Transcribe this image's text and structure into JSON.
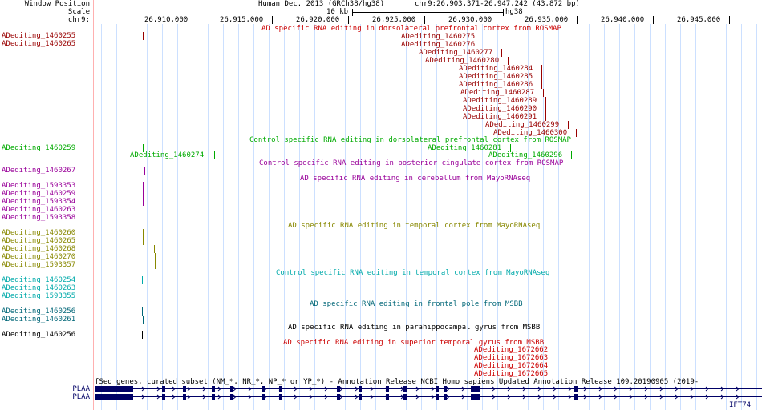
{
  "header": {
    "window_position_label": "Window Position",
    "assembly": "Human Dec. 2013 (GRCh38/hg38)",
    "position": "chr9:26,903,371-26,947,242 (43,872 bp)",
    "scale_label": "Scale",
    "scale_value": "10 kb",
    "scale_assembly": "hg38",
    "chrom_label": "chr9:",
    "ticks": [
      "26,910,000",
      "26,915,000",
      "26,920,000",
      "26,925,000",
      "26,930,000",
      "26,935,000",
      "26,940,000",
      "26,945,000"
    ]
  },
  "colors": {
    "darkred": "#990000",
    "green": "#00aa00",
    "purple": "#990099",
    "olive": "#888800",
    "cyan": "#00aaaa",
    "teal": "#006677",
    "black": "#000000",
    "red": "#cc0000",
    "navy": "#000066",
    "gridline": "#cce0ff",
    "divider": "#ffb0b0"
  },
  "tracks": {
    "t1": {
      "title": "AD specific RNA editing in dorsolateral prefrontal cortex from ROSMAP",
      "side": [
        "ADediting_1460255",
        "ADediting_1460265"
      ],
      "features": [
        "ADediting_1460275",
        "ADediting_1460276",
        "ADediting_1460277",
        "ADediting_1460280",
        "ADediting_1460284",
        "ADediting_1460285",
        "ADediting_1460286",
        "ADediting_1460287",
        "ADediting_1460289",
        "ADediting_1460290",
        "ADediting_1460291",
        "ADediting_1460299",
        "ADediting_1460300"
      ]
    },
    "t2": {
      "title": "Control specific RNA editing in dorsolateral prefrontal cortex from ROSMAP",
      "side": [
        "ADediting_1460259"
      ],
      "features": [
        "ADediting_1460281",
        "ADediting_1460274",
        "ADediting_1460296"
      ]
    },
    "t3": {
      "title": "Control specific RNA editing in posterior cingulate cortex from ROSMAP",
      "side": [
        "ADediting_1460267"
      ]
    },
    "t4": {
      "title": "AD specific RNA editing in cerebellum from MayoRNAseq",
      "side": [
        "ADediting_1593353",
        "ADediting_1460259",
        "ADediting_1593354",
        "ADediting_1460263",
        "ADediting_1593358"
      ]
    },
    "t5": {
      "title": "AD specific RNA editing in temporal cortex from MayoRNAseq",
      "side": [
        "ADediting_1460260",
        "ADediting_1460265",
        "ADediting_1460268",
        "ADediting_1460270",
        "ADediting_1593357"
      ]
    },
    "t6": {
      "title": "Control specific RNA editing in temporal cortex from MayoRNAseq",
      "side": [
        "ADediting_1460254",
        "ADediting_1460263",
        "ADediting_1593355"
      ]
    },
    "t7": {
      "title": "AD specific RNA editing in frontal pole from MSBB",
      "side": [
        "ADediting_1460256",
        "ADediting_1460261"
      ]
    },
    "t8": {
      "title": "AD specific RNA editing in parahippocampal gyrus from MSBB",
      "side": [
        "ADediting_1460256"
      ]
    },
    "t9": {
      "title": "AD specific RNA editing in superior temporal gyrus from MSBB",
      "features": [
        "ADediting_1672662",
        "ADediting_1672663",
        "ADediting_1672664",
        "ADediting_1672665"
      ]
    },
    "genes": {
      "title": "fSeq genes, curated subset (NM_*, NR_*, NP_* or YP_*) - Annotation Release NCBI Homo sapiens Updated Annotation Release 109.20190905 (2019-",
      "side": [
        "PLAA",
        "PLAA"
      ],
      "next_gene": "IFT74"
    }
  }
}
